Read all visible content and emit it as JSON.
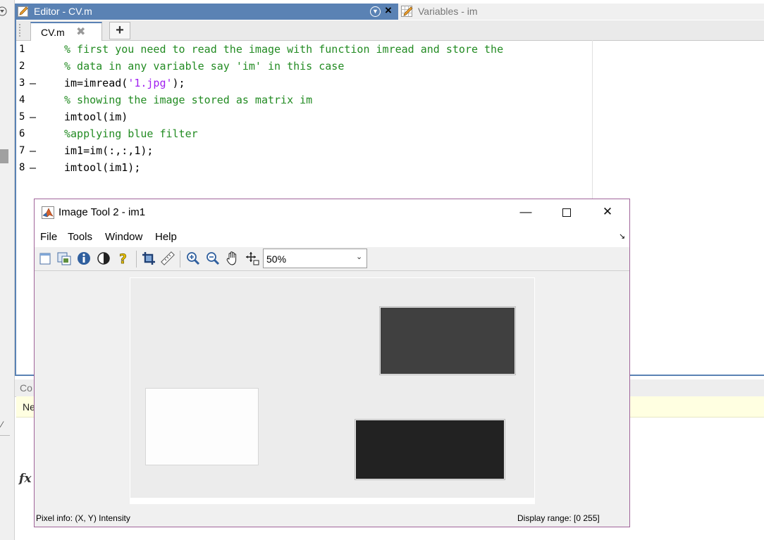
{
  "editor": {
    "title": "Editor - CV.m",
    "tab_label": "CV.m",
    "lines": [
      {
        "number": "1",
        "marker": "",
        "parts": [
          {
            "t": "% first you need to read the image with function imread and store the",
            "c": "comment"
          }
        ]
      },
      {
        "number": "2",
        "marker": "",
        "parts": [
          {
            "t": "% data in any variable say 'im' in this case",
            "c": "comment"
          }
        ]
      },
      {
        "number": "3",
        "marker": "–",
        "parts": [
          {
            "t": "im=imread(",
            "c": "code"
          },
          {
            "t": "'1.jpg'",
            "c": "string"
          },
          {
            "t": ");",
            "c": "code"
          }
        ]
      },
      {
        "number": "4",
        "marker": "",
        "parts": [
          {
            "t": "% showing the image stored as matrix im",
            "c": "comment"
          }
        ]
      },
      {
        "number": "5",
        "marker": "–",
        "parts": [
          {
            "t": "imtool(im)",
            "c": "code"
          }
        ]
      },
      {
        "number": "6",
        "marker": "",
        "parts": [
          {
            "t": "%applying blue filter",
            "c": "comment"
          }
        ]
      },
      {
        "number": "7",
        "marker": "–",
        "parts": [
          {
            "t": "im1=im(:,:,1);",
            "c": "code"
          }
        ]
      },
      {
        "number": "8",
        "marker": "–",
        "parts": [
          {
            "t": "imtool(im1);",
            "c": "code"
          }
        ]
      }
    ],
    "accent_color": "#5a82b4"
  },
  "variables": {
    "title": "Variables - im"
  },
  "command_window": {
    "title": "Co",
    "new_bar_text": "Ne",
    "fx_symbol": "fx"
  },
  "imtool": {
    "title": "Image Tool 2 - im1",
    "menu": [
      "File",
      "Tools",
      "Window",
      "Help"
    ],
    "zoom": "50%",
    "status_left": "Pixel info: (X, Y)  Intensity",
    "status_right": "Display range: [0 255]",
    "toolbar_icons": [
      "new-figure-icon",
      "overview-icon",
      "info-icon",
      "contrast-icon",
      "help-icon",
      "crop-icon",
      "ruler-icon",
      "zoom-in-icon",
      "zoom-out-icon",
      "pan-hand-icon",
      "pixel-region-icon"
    ]
  },
  "image": {
    "background_color": "#ececec",
    "shapes": [
      {
        "name": "dark-gray-rectangle",
        "color": "#404040"
      },
      {
        "name": "white-rectangle",
        "color": "#fdfdfd"
      },
      {
        "name": "black-rectangle",
        "color": "#222222"
      }
    ]
  }
}
